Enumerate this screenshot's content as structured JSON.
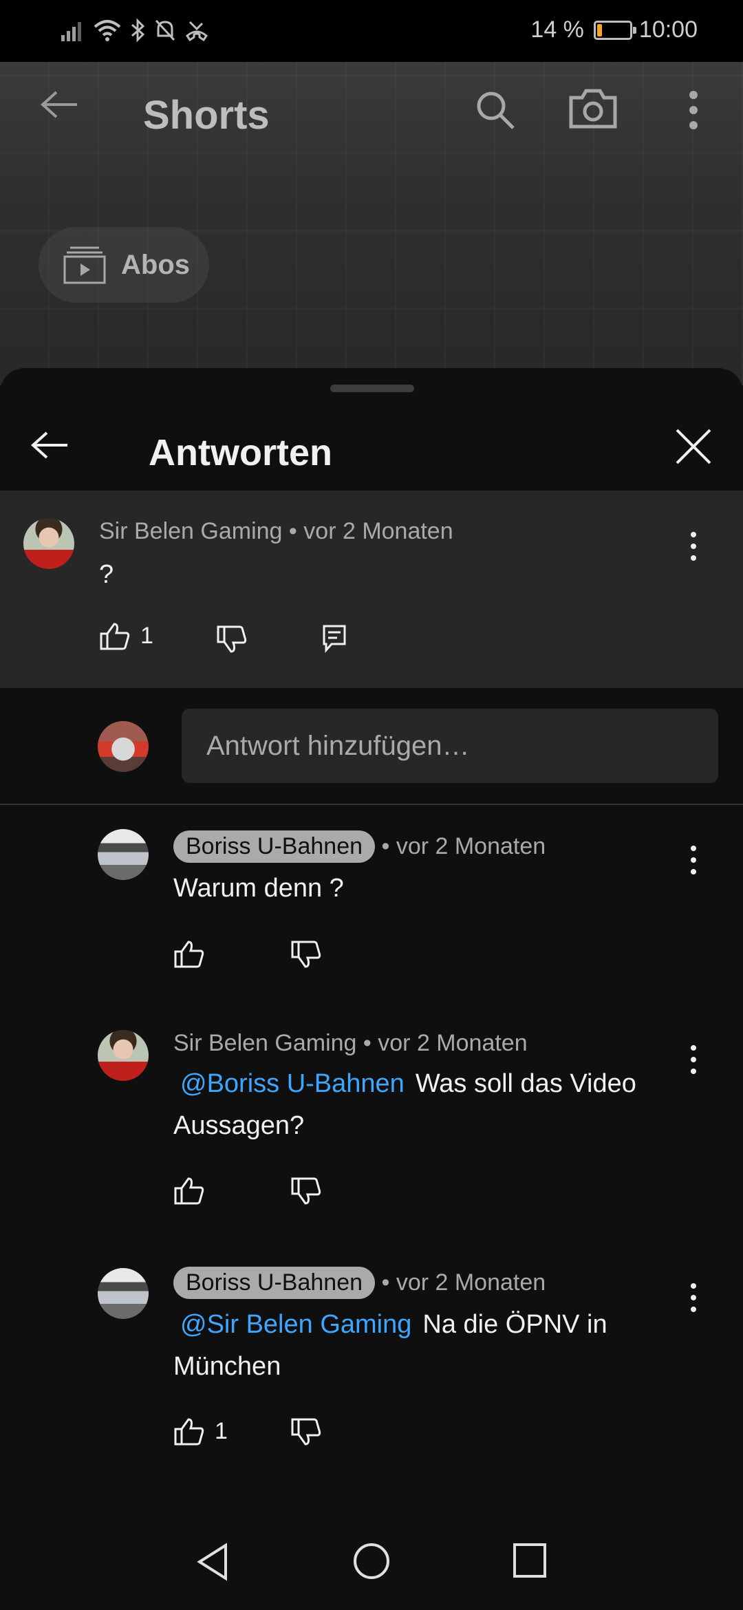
{
  "status_bar": {
    "battery_text": "14 %",
    "battery_level": 0.14,
    "time": "10:00",
    "icons": [
      "signal-icon",
      "wifi-icon",
      "bluetooth-icon",
      "mute-icon",
      "missed-call-icon"
    ]
  },
  "background_app": {
    "title": "Shorts",
    "chip_label": "Abos",
    "icons": [
      "back-arrow-icon",
      "search-icon",
      "camera-icon",
      "more-vert-icon",
      "subscriptions-icon"
    ]
  },
  "sheet": {
    "title": "Antworten",
    "parent_comment": {
      "author": "Sir Belen Gaming",
      "time": "vor 2 Monaten",
      "text": "?",
      "likes": "1"
    },
    "reply_placeholder": "Antwort hinzufügen…",
    "replies": [
      {
        "author": "Boriss U-Bahnen",
        "author_chip": true,
        "time": "• vor 2 Monaten",
        "mention": "",
        "line1": "Warum denn ?",
        "line2": "",
        "likes": ""
      },
      {
        "author": "Sir Belen Gaming",
        "author_chip": false,
        "time": "• vor 2 Monaten",
        "mention": "@Boriss U-Bahnen",
        "line1": "Was soll das Video",
        "line2": "Aussagen?",
        "likes": ""
      },
      {
        "author": "Boriss U-Bahnen",
        "author_chip": true,
        "time": "• vor 2 Monaten",
        "mention": "@Sir Belen Gaming",
        "line1": "Na die ÖPNV in",
        "line2": "München",
        "likes": "1"
      }
    ]
  },
  "colors": {
    "background": "#0f0f0f",
    "surface": "#272727",
    "mention": "#3ea6ff",
    "secondary_text": "#aaaaaa",
    "battery": "#f5a623"
  }
}
